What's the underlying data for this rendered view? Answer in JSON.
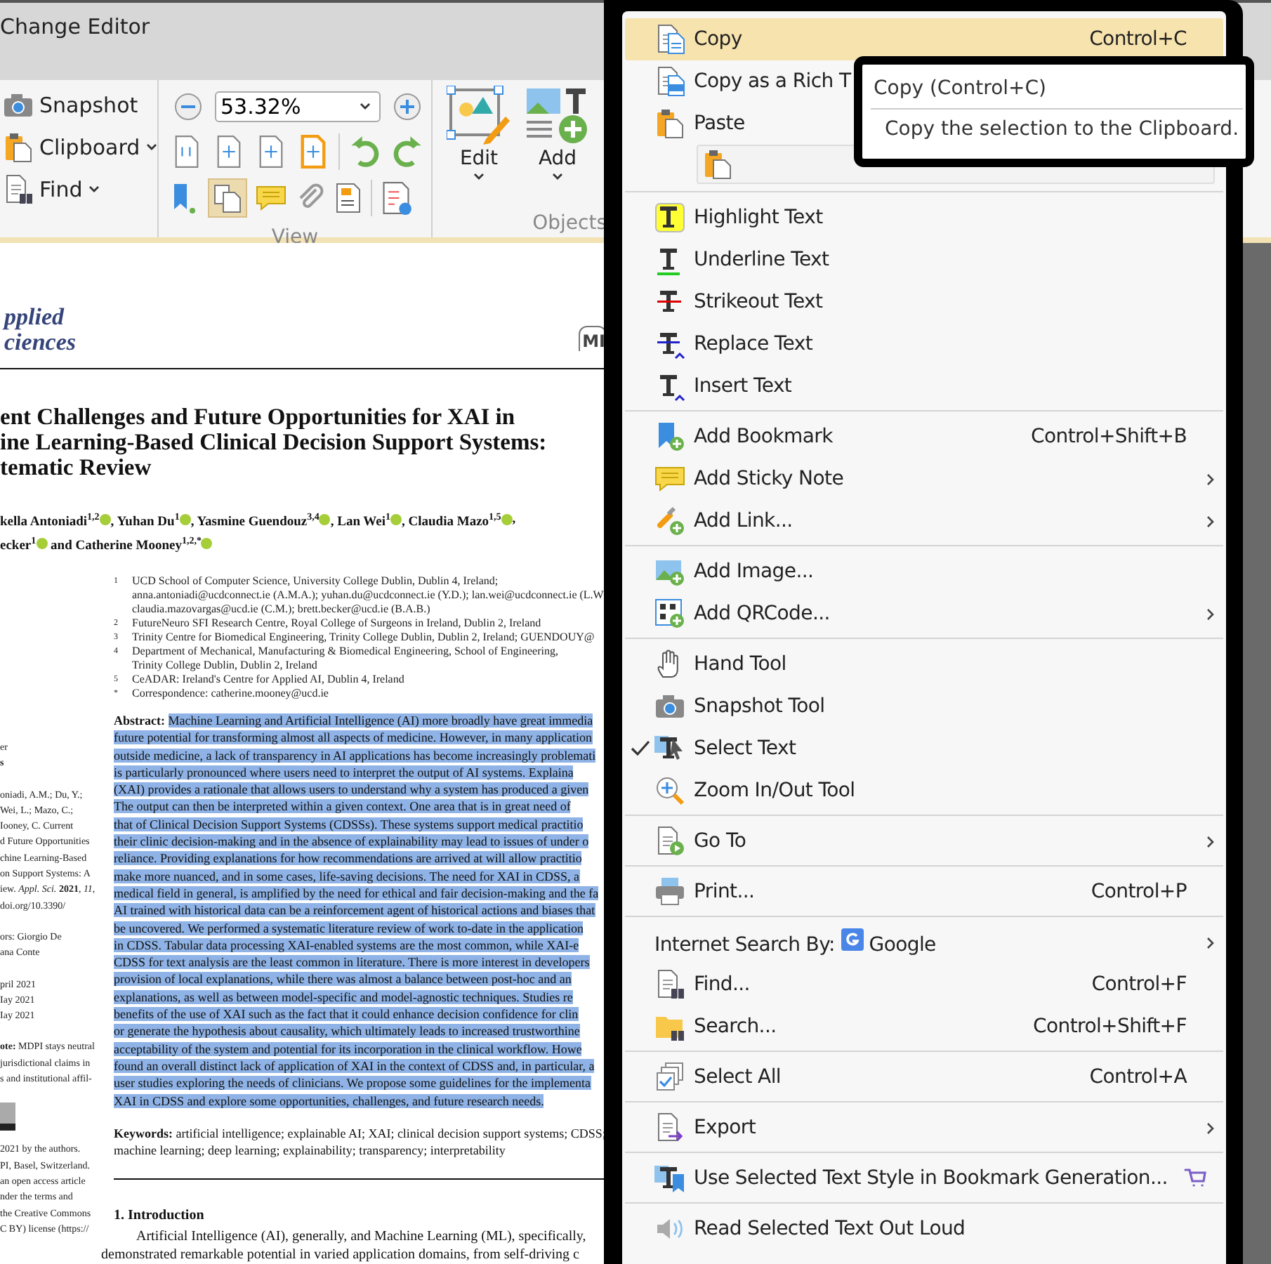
{
  "window": {
    "title": "Change Editor"
  },
  "ribbon": {
    "groups": [
      {
        "kind": "tools",
        "items": [
          {
            "label": "Snapshot",
            "dropdown": false
          },
          {
            "label": "Clipboard",
            "dropdown": true
          },
          {
            "label": "Find",
            "dropdown": true
          }
        ]
      },
      {
        "kind": "view",
        "label": "View",
        "zoom": "53.32%"
      },
      {
        "kind": "objects",
        "label": "Objects",
        "buttons": [
          {
            "label": "Edit"
          },
          {
            "label": "Add"
          }
        ]
      }
    ]
  },
  "document": {
    "journal": [
      "pplied",
      "ciences"
    ],
    "logo": "MI",
    "title": [
      "ent Challenges and Future Opportunities for XAI in",
      "ine Learning-Based Clinical Decision Support Systems:",
      "tematic Review"
    ],
    "authors": [
      [
        {
          "text": "kella Antoniadi",
          "sup": "1,2",
          "orcid": true
        },
        {
          "text": ", Yuhan Du",
          "sup": "1",
          "orcid": true
        },
        {
          "text": ", Yasmine Guendouz",
          "sup": "3,4",
          "orcid": true
        },
        {
          "text": ", Lan Wei",
          "sup": "1",
          "orcid": true
        },
        {
          "text": ", Claudia Mazo",
          "sup": "1,5",
          "orcid": true
        },
        {
          "text": ",",
          "orcid": false
        }
      ],
      [
        {
          "text": "ecker",
          "sup": "1",
          "orcid": true
        },
        {
          "text": " and Catherine Mooney",
          "sup": "1,2,*",
          "orcid": true
        }
      ]
    ],
    "affiliations": [
      {
        "mark": "1",
        "lines": [
          "UCD School of Computer Science, University College Dublin, Dublin 4, Ireland;",
          "anna.antoniadi@ucdconnect.ie (A.M.A.); yuhan.du@ucdconnect.ie (Y.D.); lan.wei@ucdconnect.ie (L.W",
          "claudia.mazovargas@ucd.ie (C.M.); brett.becker@ucd.ie (B.A.B.)"
        ]
      },
      {
        "mark": "2",
        "lines": [
          "FutureNeuro SFI Research Centre, Royal College of Surgeons in Ireland, Dublin 2, Ireland"
        ]
      },
      {
        "mark": "3",
        "lines": [
          "Trinity Centre for Biomedical Engineering, Trinity College Dublin, Dublin 2, Ireland; GUENDOUY@"
        ]
      },
      {
        "mark": "4",
        "lines": [
          "Department of Mechanical, Manufacturing & Biomedical Engineering, School of Engineering,",
          "Trinity College Dublin, Dublin 2, Ireland"
        ]
      },
      {
        "mark": "5",
        "lines": [
          "CeADAR: Ireland's Centre for Applied AI, Dublin 4, Ireland"
        ]
      },
      {
        "mark": "*",
        "lines": [
          "Correspondence: catherine.mooney@ucd.ie"
        ]
      }
    ],
    "sidebar": [
      {
        "kind": "text",
        "lines": [
          "er",
          "**s**"
        ]
      },
      {
        "kind": "text",
        "lines": [
          "oniadi, A.M.; Du, Y.;",
          "Wei, L.; Mazo, C.;",
          "Iooney, C. Current",
          "d Future Opportunities",
          "chine Learning-Based",
          "on Support Systems: A",
          "iew. *Appl. Sci.* **2021**, *11*,",
          "doi.org/10.3390/"
        ]
      },
      {
        "kind": "text",
        "lines": [
          "ors: Giorgio De",
          "ana Conte"
        ]
      },
      {
        "kind": "text",
        "lines": [
          "pril 2021",
          "Iay 2021",
          "Iay 2021"
        ]
      },
      {
        "kind": "text",
        "lines": [
          "**ote:** MDPI stays neutral",
          "jurisdictional claims in",
          "s and institutional affil-"
        ]
      },
      {
        "kind": "picture"
      },
      {
        "kind": "text",
        "lines": [
          "2021 by the authors.",
          "PI, Basel, Switzerland.",
          "an open access article",
          "nder the terms and",
          "the Creative Commons",
          "C BY) license (https://"
        ]
      }
    ],
    "abstract": {
      "label": "Abstract:",
      "selected": true,
      "lines": [
        "Machine Learning and Artificial Intelligence (AI) more broadly have great immedia",
        "future potential for transforming almost all aspects of medicine. However, in many application",
        "outside medicine, a lack of transparency in AI applications has become increasingly problemati",
        "is particularly pronounced where users need to interpret the output of AI systems. Explaina",
        "(XAI) provides a rationale that allows users to understand why a system has produced a given",
        "The output can then be interpreted within a given context. One area that is in great need of",
        "that of Clinical Decision Support Systems (CDSSs). These systems support medical practitio",
        "their clinic decision-making and in the absence of explainability may lead to issues of under o",
        "reliance. Providing explanations for how recommendations are arrived at will allow practitio",
        "make more nuanced, and in some cases, life-saving decisions. The need for XAI in CDSS, a",
        "medical field in general, is amplified by the need for ethical and fair decision-making and the fa",
        "AI trained with historical data can be a reinforcement agent of historical actions and biases that",
        "be uncovered. We performed a systematic literature review of work to-date in the application",
        "in CDSS. Tabular data processing XAI-enabled systems are the most common, while XAI-e",
        "CDSS for text analysis are the least common in literature. There is more interest in developers",
        "provision of local explanations, while there was almost a balance between post-hoc and an",
        "explanations, as well as between model-specific and model-agnostic techniques. Studies re",
        "benefits of the use of XAI such as the fact that it could enhance decision confidence for clin",
        "or generate the hypothesis about causality, which ultimately leads to increased trustworthine",
        "acceptability of the system and potential for its incorporation in the clinical workflow. Howe",
        "found an overall distinct lack of application of XAI in the context of CDSS and, in particular, a",
        "user studies exploring the needs of clinicians. We propose some guidelines for the implementa",
        "XAI in CDSS and explore some opportunities, challenges, and future research needs."
      ]
    },
    "keywords": {
      "label": "Keywords:",
      "lines": [
        "artificial intelligence; explainable AI; XAI; clinical decision support systems; CDSS;",
        "machine learning; deep learning; explainability; transparency; interpretability"
      ]
    },
    "section_heading": "1. Introduction",
    "paragraph": [
      "Artificial Intelligence (AI), generally, and Machine Learning (ML), specifically,",
      "demonstrated remarkable potential in varied application domains, from self-driving c"
    ]
  },
  "context_menu": {
    "sections": [
      [
        {
          "kind": "command",
          "label": "Copy",
          "shortcut": "Control+C",
          "submenu": false,
          "checked": false,
          "highlighted": true
        },
        {
          "kind": "command",
          "label": "Copy as a Rich T",
          "checked": false,
          "highlighted": false
        },
        {
          "kind": "command",
          "label": "Paste",
          "checked": false,
          "highlighted": false
        },
        {
          "kind": "paste-box"
        }
      ],
      [
        {
          "kind": "command",
          "label": "Highlight Text",
          "submenu": false,
          "checked": false,
          "highlighted": false
        },
        {
          "kind": "command",
          "label": "Underline Text",
          "submenu": false,
          "checked": false,
          "highlighted": false
        },
        {
          "kind": "command",
          "label": "Strikeout Text",
          "submenu": false,
          "checked": false,
          "highlighted": false
        },
        {
          "kind": "command",
          "label": "Replace Text",
          "submenu": false,
          "checked": false,
          "highlighted": false
        },
        {
          "kind": "command",
          "label": "Insert Text",
          "submenu": false,
          "checked": false,
          "highlighted": false
        }
      ],
      [
        {
          "kind": "command",
          "label": "Add Bookmark",
          "shortcut": "Control+Shift+B",
          "submenu": false,
          "checked": false,
          "highlighted": false
        },
        {
          "kind": "command",
          "label": "Add Sticky Note",
          "submenu": true,
          "checked": false,
          "highlighted": false
        },
        {
          "kind": "command",
          "label": "Add Link...",
          "submenu": true,
          "checked": false,
          "highlighted": false
        }
      ],
      [
        {
          "kind": "command",
          "label": "Add Image...",
          "submenu": false,
          "checked": false,
          "highlighted": false
        },
        {
          "kind": "command",
          "label": "Add QRCode...",
          "submenu": true,
          "checked": false,
          "highlighted": false
        }
      ],
      [
        {
          "kind": "command",
          "label": "Hand Tool",
          "submenu": false,
          "checked": false,
          "highlighted": false
        },
        {
          "kind": "command",
          "label": "Snapshot Tool",
          "submenu": false,
          "checked": false,
          "highlighted": false
        },
        {
          "kind": "command",
          "label": "Select Text",
          "submenu": false,
          "checked": true,
          "highlighted": false
        },
        {
          "kind": "command",
          "label": "Zoom In/Out Tool",
          "submenu": false,
          "checked": false,
          "highlighted": false
        }
      ],
      [
        {
          "kind": "command",
          "label": "Go To",
          "submenu": true,
          "checked": false,
          "highlighted": false
        }
      ],
      [
        {
          "kind": "command",
          "label": "Print...",
          "shortcut": "Control+P",
          "submenu": false,
          "checked": false,
          "highlighted": false
        }
      ],
      [
        {
          "kind": "search-provider",
          "label": "Internet Search By:",
          "provider": "Google",
          "submenu": true,
          "checked": false,
          "highlighted": false
        },
        {
          "kind": "command",
          "label": "Find...",
          "shortcut": "Control+F",
          "submenu": false,
          "checked": false,
          "highlighted": false
        },
        {
          "kind": "command",
          "label": "Search...",
          "shortcut": "Control+Shift+F",
          "submenu": false,
          "checked": false,
          "highlighted": false
        }
      ],
      [
        {
          "kind": "command",
          "label": "Select All",
          "shortcut": "Control+A",
          "submenu": false,
          "checked": false,
          "highlighted": false
        }
      ],
      [
        {
          "kind": "command",
          "label": "Export",
          "submenu": true,
          "checked": false,
          "highlighted": false
        }
      ],
      [
        {
          "kind": "command",
          "label": "Use Selected Text Style in Bookmark Generation...",
          "submenu": false,
          "checked": false,
          "highlighted": false,
          "premium": true
        }
      ],
      [
        {
          "kind": "command",
          "label": "Read Selected Text Out Loud",
          "submenu": false,
          "checked": false,
          "highlighted": false
        }
      ]
    ]
  },
  "tooltip": {
    "title": "Copy (Control+C)",
    "description": "Copy the selection to the Clipboard."
  }
}
